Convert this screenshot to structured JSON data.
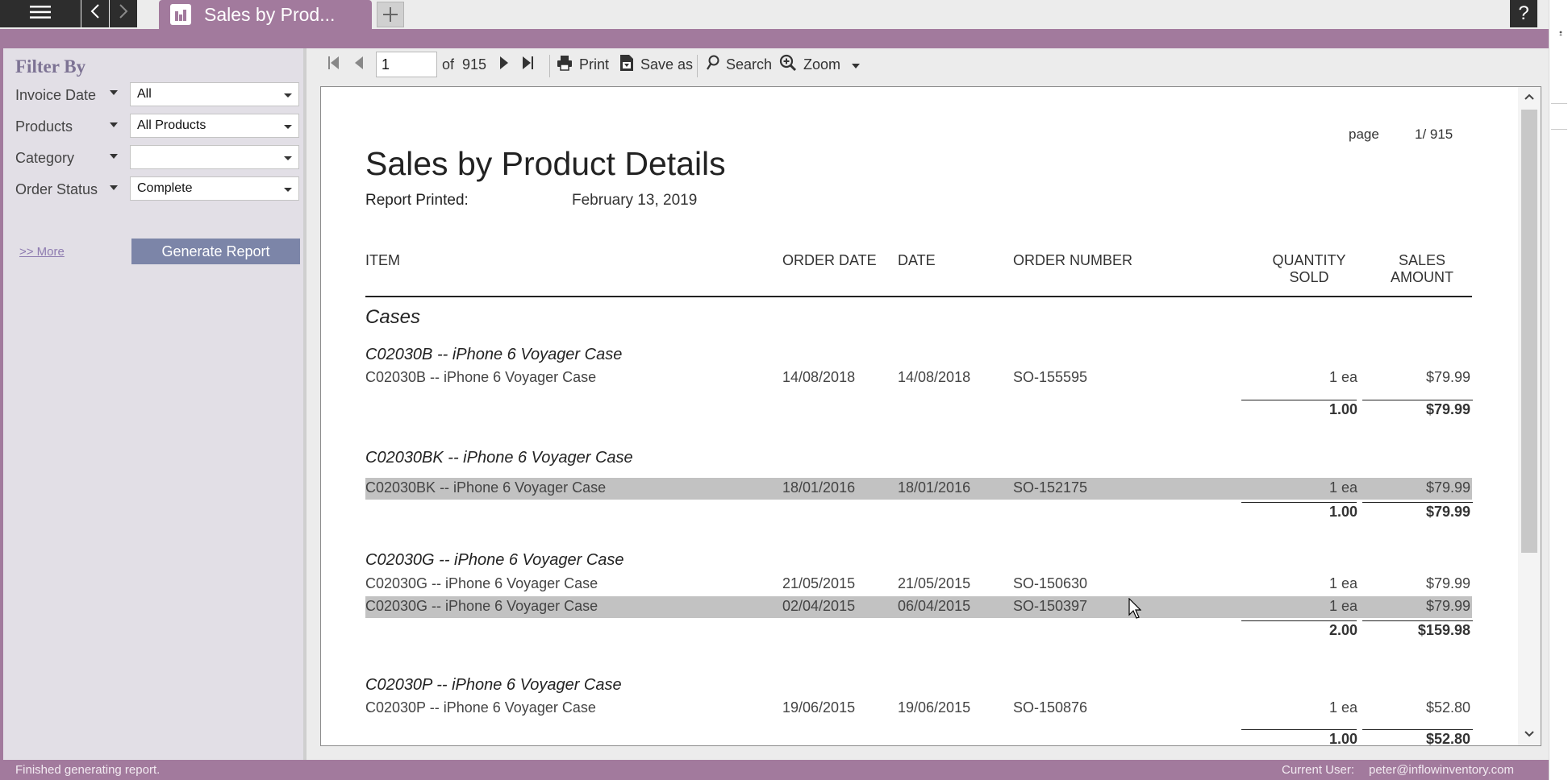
{
  "titlebar": {
    "tab_title": "Sales by Prod...",
    "help_label": "?"
  },
  "sidebar": {
    "title": "Filter By",
    "filters": [
      {
        "label": "Invoice Date",
        "value": "All"
      },
      {
        "label": "Products",
        "value": "All Products"
      },
      {
        "label": "Category",
        "value": ""
      },
      {
        "label": "Order Status",
        "value": "Complete"
      }
    ],
    "more_link": ">> More",
    "generate_label": "Generate Report"
  },
  "toolbar": {
    "page_value": "1",
    "of_label": "of",
    "total_pages": "915",
    "print_label": "Print",
    "save_label": "Save as",
    "search_label": "Search",
    "zoom_label": "Zoom"
  },
  "report": {
    "page_label": "page",
    "page_num": "1/ 915",
    "title": "Sales by Product Details",
    "printed_label": "Report Printed:",
    "printed_date": "February 13, 2019",
    "columns": {
      "item": "ITEM",
      "order_date": "ORDER DATE",
      "date": "DATE",
      "order_number": "ORDER NUMBER",
      "qty_1": "QUANTITY",
      "qty_2": "SOLD",
      "sales_1": "SALES",
      "sales_2": "AMOUNT"
    },
    "category": "Cases",
    "groups": [
      {
        "name": "C02030B -- iPhone 6 Voyager Case",
        "rows": [
          {
            "item": "C02030B -- iPhone 6 Voyager Case",
            "order_date": "14/08/2018",
            "date": "14/08/2018",
            "order_number": "SO-155595",
            "qty": "1 ea",
            "amount": "$79.99",
            "highlight": false
          }
        ],
        "total_qty": "1.00",
        "total_amount": "$79.99"
      },
      {
        "name": "C02030BK -- iPhone 6 Voyager Case",
        "rows": [
          {
            "item": "C02030BK -- iPhone 6 Voyager Case",
            "order_date": "18/01/2016",
            "date": "18/01/2016",
            "order_number": "SO-152175",
            "qty": "1 ea",
            "amount": "$79.99",
            "highlight": true
          }
        ],
        "total_qty": "1.00",
        "total_amount": "$79.99"
      },
      {
        "name": "C02030G -- iPhone 6 Voyager Case",
        "rows": [
          {
            "item": "C02030G -- iPhone 6 Voyager Case",
            "order_date": "21/05/2015",
            "date": "21/05/2015",
            "order_number": "SO-150630",
            "qty": "1 ea",
            "amount": "$79.99",
            "highlight": false
          },
          {
            "item": "C02030G -- iPhone 6 Voyager Case",
            "order_date": "02/04/2015",
            "date": "06/04/2015",
            "order_number": "SO-150397",
            "qty": "1 ea",
            "amount": "$79.99",
            "highlight": true
          }
        ],
        "total_qty": "2.00",
        "total_amount": "$159.98"
      },
      {
        "name": "C02030P -- iPhone 6 Voyager Case",
        "rows": [
          {
            "item": "C02030P -- iPhone 6 Voyager Case",
            "order_date": "19/06/2015",
            "date": "19/06/2015",
            "order_number": "SO-150876",
            "qty": "1 ea",
            "amount": "$52.80",
            "highlight": false
          }
        ],
        "total_qty": "1.00",
        "total_amount": "$52.80"
      }
    ]
  },
  "status": {
    "message": "Finished generating report.",
    "user_label": "Current User:",
    "user_email": "peter@inflowinventory.com"
  }
}
